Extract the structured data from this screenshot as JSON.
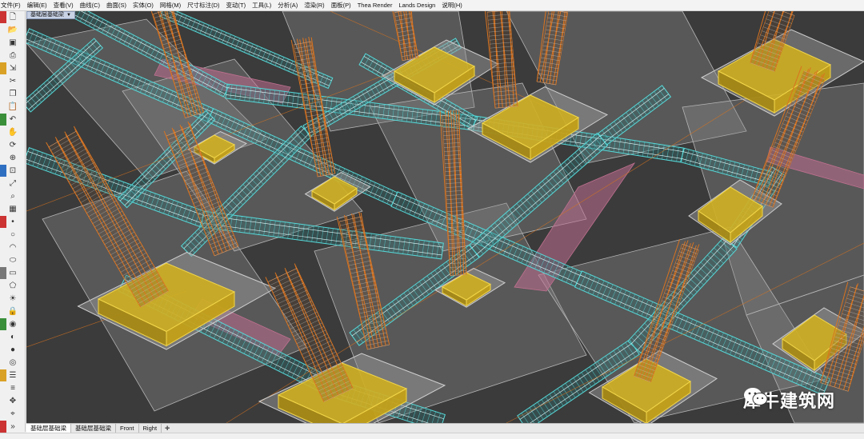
{
  "menu": [
    "文件(F)",
    "编辑(E)",
    "查看(V)",
    "曲线(C)",
    "曲面(S)",
    "实体(O)",
    "网格(M)",
    "尺寸标注(D)",
    "变动(T)",
    "工具(L)",
    "分析(A)",
    "渲染(R)",
    "面板(P)",
    "Thea Render",
    "Lands Design",
    "说明(H)"
  ],
  "viewport": {
    "title": "基础层基础梁",
    "background": "#3b3b3b",
    "rebar_color": "#d9731f",
    "beam_color": "#57d8d8",
    "footing_color": "#d4b21b",
    "pink_color": "#c07090"
  },
  "tabs": [
    "基础层基础梁",
    "基础层基础梁",
    "Front",
    "Right"
  ],
  "watermark": {
    "text": "犀牛建筑网",
    "icon": "wechat-icon"
  },
  "toolbar": {
    "icons": [
      "new-file-icon",
      "open-folder-icon",
      "save-icon",
      "print-icon",
      "import-icon",
      "cut-icon",
      "copy-icon",
      "paste-icon",
      "undo-icon",
      "hand-pan-icon",
      "rotate-view-icon",
      "zoom-icon",
      "zoom-window-icon",
      "zoom-extents-icon",
      "zoom-selected-icon",
      "grid-icon",
      "point-icon",
      "circle-icon",
      "arc-icon",
      "ellipse-icon",
      "rectangle-icon",
      "polygon-icon",
      "light-icon",
      "lock-icon",
      "render-icon",
      "color-icon",
      "sphere-icon",
      "material-icon",
      "layer-icon",
      "properties-icon",
      "gumball-icon",
      "snap-icon",
      "more-icon"
    ]
  }
}
